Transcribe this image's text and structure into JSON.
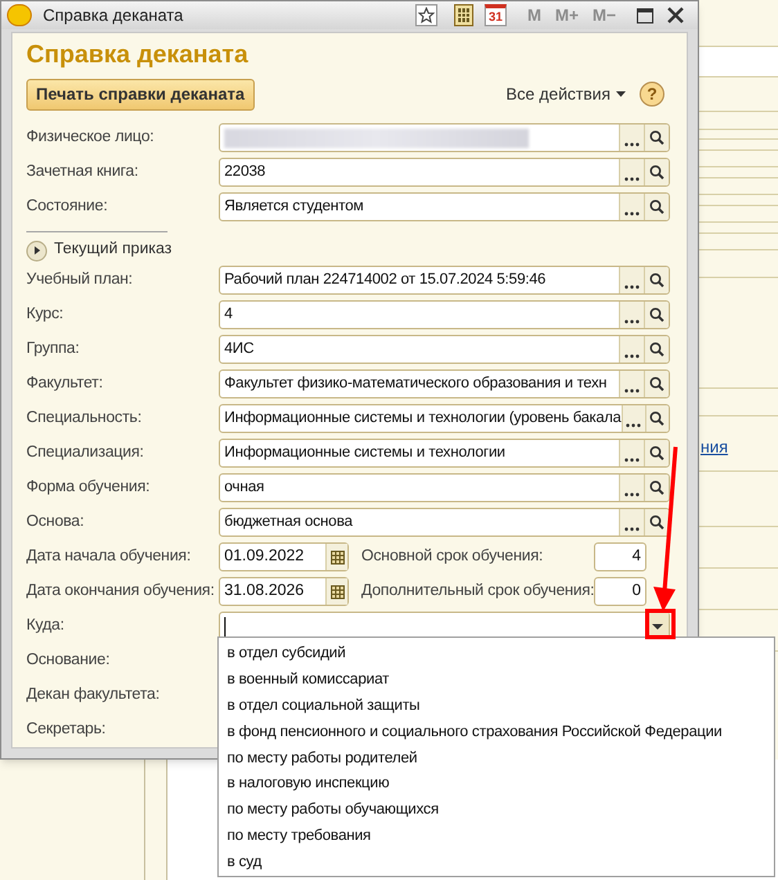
{
  "window": {
    "title": "Справка деканата",
    "toolbar": {
      "calendar_day": "31",
      "memory_buttons": [
        {
          "label": "M",
          "disabled": true
        },
        {
          "label": "M+",
          "disabled": true
        },
        {
          "label": "M−",
          "disabled": true
        }
      ]
    }
  },
  "form": {
    "heading": "Справка деканата",
    "print_button": "Печать справки деканата",
    "all_actions": "Все действия",
    "help": "?",
    "fields": [
      {
        "kind": "ref",
        "label": "Физическое лицо:",
        "redacted": true
      },
      {
        "kind": "ref",
        "label": "Зачетная книга:",
        "value": "22038"
      },
      {
        "kind": "ref",
        "label": "Состояние:",
        "value": "Является студентом"
      }
    ],
    "section": {
      "label": "Текущий приказ",
      "expanded": false
    },
    "order_fields": [
      {
        "kind": "ref",
        "label": "Учебный план:",
        "value": "Рабочий план 224714002 от 15.07.2024 5:59:46"
      },
      {
        "kind": "ref",
        "label": "Курс:",
        "value": "4"
      },
      {
        "kind": "ref",
        "label": "Группа:",
        "value": "4ИС"
      },
      {
        "kind": "ref",
        "label": "Факультет:",
        "value": "Факультет физико-математического образования и техн"
      },
      {
        "kind": "ref",
        "label": "Специальность:",
        "value": "Информационные системы и технологии (уровень бакала"
      },
      {
        "kind": "ref",
        "label": "Специализация:",
        "value": "Информационные системы и технологии"
      },
      {
        "kind": "ref",
        "label": "Форма обучения:",
        "value": "очная"
      },
      {
        "kind": "ref",
        "label": "Основа:",
        "value": "бюджетная основа"
      },
      {
        "kind": "date",
        "label": "Дата начала обучения:",
        "value": "01.09.2022",
        "label_2": "Основной срок обучения:",
        "value_2": "4"
      },
      {
        "kind": "date",
        "label": "Дата окончания обучения:",
        "value": "31.08.2026",
        "label_2": "Дополнительный срок обучения:",
        "value_2": "0"
      },
      {
        "kind": "select",
        "label": "Куда:",
        "open": true
      },
      {
        "kind": "hidden",
        "label": "Основание:"
      },
      {
        "kind": "hidden",
        "label": "Декан факультета:"
      },
      {
        "kind": "hidden",
        "label": "Секретарь:"
      }
    ]
  },
  "dropdown": {
    "items": [
      "в отдел субсидий",
      "в военный комиссариат",
      "в отдел социальной защиты",
      "в фонд пенсионного и социального страхования Российской Федерации",
      "по месту работы родителей",
      "в налоговую инспекцию",
      "по месту работы обучающихся",
      "по месту требования",
      "в суд"
    ]
  },
  "background": {
    "link": "ния"
  }
}
